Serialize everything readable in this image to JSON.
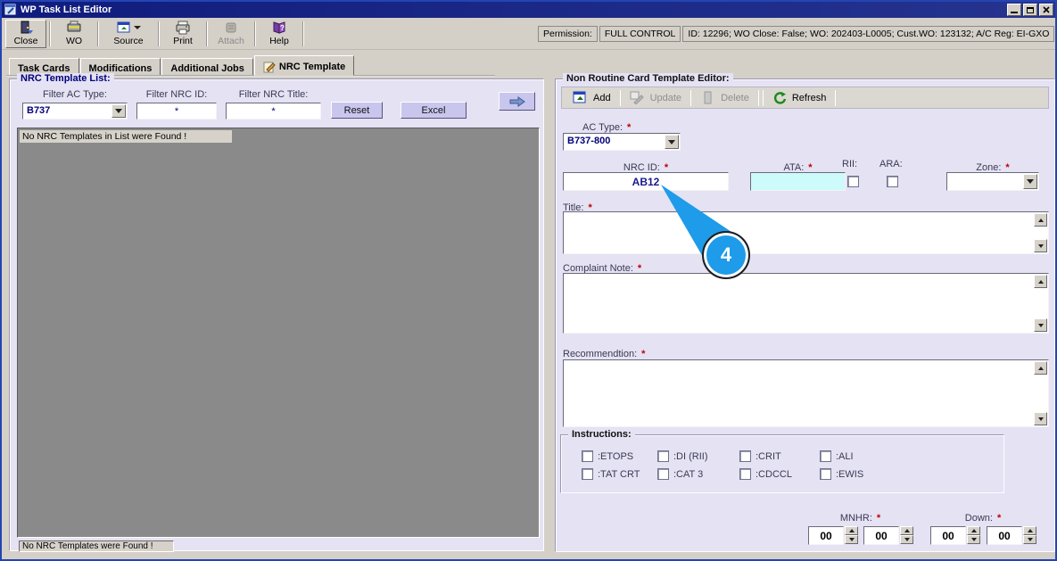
{
  "window": {
    "title": "WP Task List Editor"
  },
  "toolbar": {
    "buttons": [
      {
        "label": "Close",
        "enabled": true
      },
      {
        "label": "WO",
        "enabled": true
      },
      {
        "label": "Source",
        "enabled": true,
        "has_dropdown": true
      },
      {
        "label": "Print",
        "enabled": true
      },
      {
        "label": "Attach",
        "enabled": false
      },
      {
        "label": "Help",
        "enabled": true
      }
    ]
  },
  "permission_bar": {
    "label": "Permission:",
    "value": "FULL CONTROL",
    "details": "ID: 12296; WO Close: False; WO: 202403-L0005; Cust.WO: 123132; A/C Reg: EI-GXO"
  },
  "tabs": [
    {
      "label": "Task Cards",
      "active": false
    },
    {
      "label": "Modifications",
      "active": false
    },
    {
      "label": "Additional Jobs",
      "active": false
    },
    {
      "label": "NRC Template",
      "active": true
    }
  ],
  "left_panel": {
    "title": "NRC Template List:",
    "filters": {
      "ac_type": {
        "label": "Filter AC Type:",
        "value": "B737"
      },
      "nrc_id": {
        "label": "Filter NRC ID:",
        "value": "*"
      },
      "nrc_title": {
        "label": "Filter NRC Title:",
        "value": "*"
      }
    },
    "buttons": {
      "reset": "Reset",
      "excel": "Excel"
    },
    "list_empty_message": "No NRC Templates in List were Found !",
    "status_message": "No NRC Templates were Found !"
  },
  "right_panel": {
    "title": "Non Routine Card Template Editor:",
    "required_marker": "*",
    "toolbar": {
      "add": "Add",
      "update": "Update",
      "delete": "Delete",
      "refresh": "Refresh"
    },
    "fields": {
      "ac_type": {
        "label": "AC Type:",
        "required": true,
        "value": "B737-800"
      },
      "nrc_id": {
        "label": "NRC ID:",
        "required": true,
        "value": "AB12"
      },
      "ata": {
        "label": "ATA:",
        "required": true,
        "value": ""
      },
      "rii": {
        "label": "RII:",
        "checked": false
      },
      "ara": {
        "label": "ARA:",
        "checked": false
      },
      "zone": {
        "label": "Zone:",
        "required": true,
        "value": ""
      },
      "title": {
        "label": "Title:",
        "required": true,
        "value": ""
      },
      "complaint_note": {
        "label": "Complaint Note:",
        "required": true,
        "value": ""
      },
      "recommendation": {
        "label": "Recommendtion:",
        "required": true,
        "value": ""
      }
    },
    "instructions": {
      "title": "Instructions:",
      "checkboxes": [
        ":ETOPS",
        ":DI (RII)",
        ":CRIT",
        ":ALI",
        ":TAT CRT",
        ":CAT 3",
        ":CDCCL",
        ":EWIS"
      ]
    },
    "spinners": {
      "mnhr_label": "MNHR:",
      "down_label": "Down:",
      "values": [
        "00",
        "00",
        "00",
        "00"
      ]
    }
  },
  "annotation": {
    "number": "4"
  },
  "icons": {
    "app": "window-app",
    "close": "exit-door",
    "wo": "printer-device",
    "source": "form-window",
    "print": "printer",
    "attach": "stamp",
    "help": "book-question",
    "help_glyph": "?",
    "nrc_tab": "note-pencil",
    "panel_arrow": "right-arrow",
    "add": "form-window-arrow",
    "update": "form-pencil",
    "delete": "column",
    "refresh": "circular-arrow"
  },
  "colors": {
    "accent_blue": "#1E9BE9",
    "titlebar_navy": "#101C7D",
    "panel_lavender": "#E4E2F3",
    "field_cyan": "#CDFAFA",
    "button_purple": "#C9C6EE",
    "required_red": "#C00000",
    "navy_text": "#00007A",
    "list_gray": "#8A8A8A"
  }
}
